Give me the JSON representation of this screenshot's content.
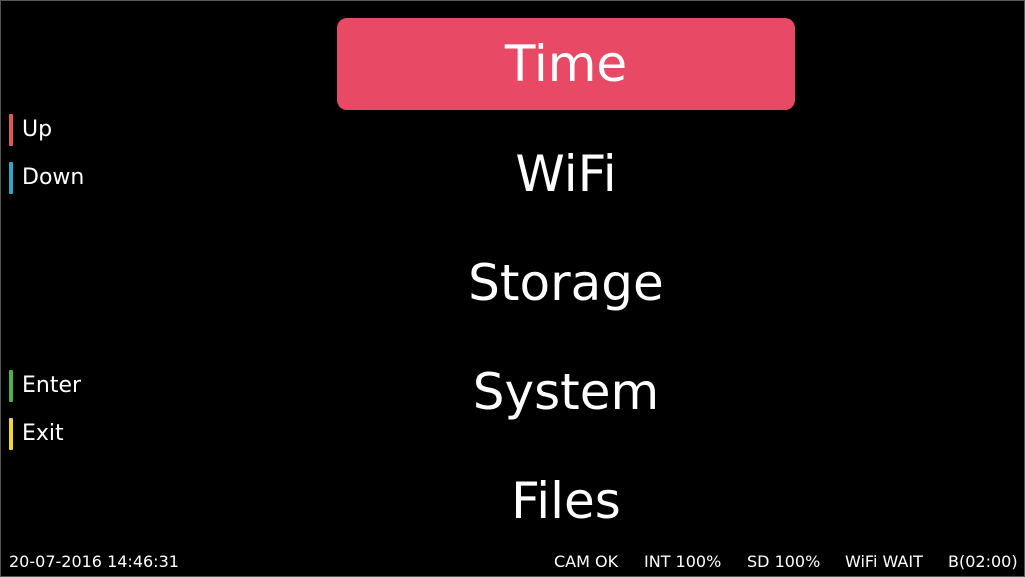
{
  "colors": {
    "background": "#000000",
    "selected_bg": "#e84a66",
    "up": "#e05555",
    "down": "#2fa8c8",
    "enter": "#4caf50",
    "exit": "#f2d33a"
  },
  "hints": {
    "up": "Up",
    "down": "Down",
    "enter": "Enter",
    "exit": "Exit"
  },
  "menu": {
    "selected_index": 0,
    "items": [
      "Time",
      "WiFi",
      "Storage",
      "System",
      "Files"
    ]
  },
  "status": {
    "datetime": "20-07-2016 14:46:31",
    "cam": "CAM OK",
    "int": "INT 100%",
    "sd": "SD 100%",
    "wifi": "WiFi WAIT",
    "battery": "B(02:00)"
  }
}
